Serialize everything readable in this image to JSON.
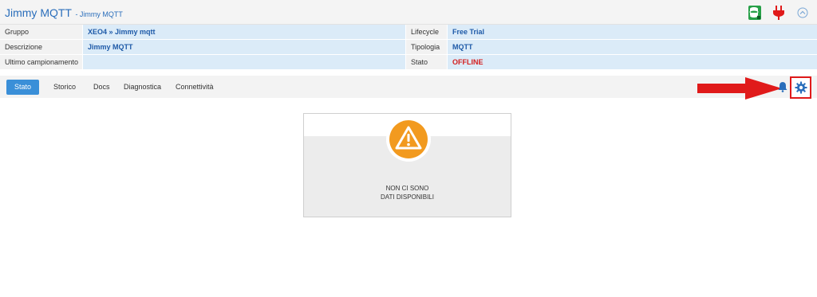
{
  "header": {
    "title": "Jimmy MQTT",
    "subtitle": "- Jimmy MQTT",
    "icons": [
      "database-icon",
      "plug-icon",
      "chevron-up-circle-icon"
    ]
  },
  "info": {
    "rows": [
      {
        "label": "Gruppo",
        "value": "XEO4 » Jimmy mqtt",
        "label2": "Lifecycle",
        "value2": "Free Trial"
      },
      {
        "label": "Descrizione",
        "value": "Jimmy MQTT",
        "label2": "Tipologia",
        "value2": "MQTT"
      },
      {
        "label": "Ultimo campionamento",
        "value": "",
        "label2": "Stato",
        "value2": "OFFLINE"
      }
    ]
  },
  "tabs": {
    "items": [
      "Stato",
      "Storico",
      "Docs",
      "Diagnostica",
      "Connettività"
    ],
    "active": "Stato"
  },
  "toolbar": {
    "icons": [
      "bell-icon",
      "gear-icon"
    ],
    "highlight_color": "#e01a1a"
  },
  "empty_state": {
    "icon": "warning-icon",
    "line1": "NON CI SONO",
    "line2": "DATI DISPONIBILI",
    "accent": "#f29a1f"
  },
  "colors": {
    "brand": "#2a6ebb",
    "tab_active": "#3a8fd8",
    "value_bg": "#dbebf8",
    "offline": "#d32020"
  }
}
